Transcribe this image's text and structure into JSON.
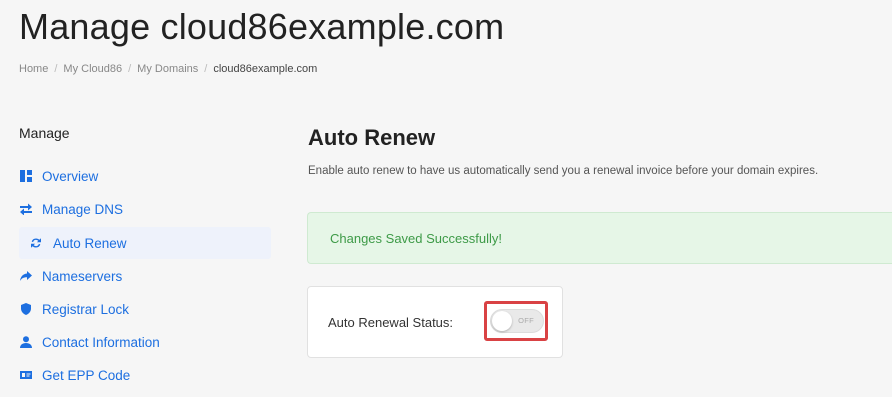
{
  "page": {
    "title": "Manage cloud86example.com"
  },
  "breadcrumb": {
    "items": [
      "Home",
      "My Cloud86",
      "My Domains"
    ],
    "separator": "/",
    "current": "cloud86example.com"
  },
  "sidebar": {
    "title": "Manage",
    "items": [
      {
        "label": "Overview",
        "icon": "dashboard-icon"
      },
      {
        "label": "Manage DNS",
        "icon": "swap-arrows-icon"
      },
      {
        "label": "Auto Renew",
        "icon": "sync-icon",
        "active": true
      },
      {
        "label": "Nameservers",
        "icon": "share-arrow-icon"
      },
      {
        "label": "Registrar Lock",
        "icon": "shield-icon"
      },
      {
        "label": "Contact Information",
        "icon": "user-icon"
      },
      {
        "label": "Get EPP Code",
        "icon": "id-card-icon"
      }
    ]
  },
  "main": {
    "title": "Auto Renew",
    "description": "Enable auto renew to have us automatically send you a renewal invoice before your domain expires.",
    "alert": "Changes Saved Successfully!",
    "status": {
      "label": "Auto Renewal Status:",
      "toggle_text": "OFF",
      "enabled": false
    }
  },
  "colors": {
    "accent": "#1d6fe0",
    "success_text": "#3d9a47",
    "success_bg": "#e6f6e7",
    "highlight": "#d94244"
  }
}
